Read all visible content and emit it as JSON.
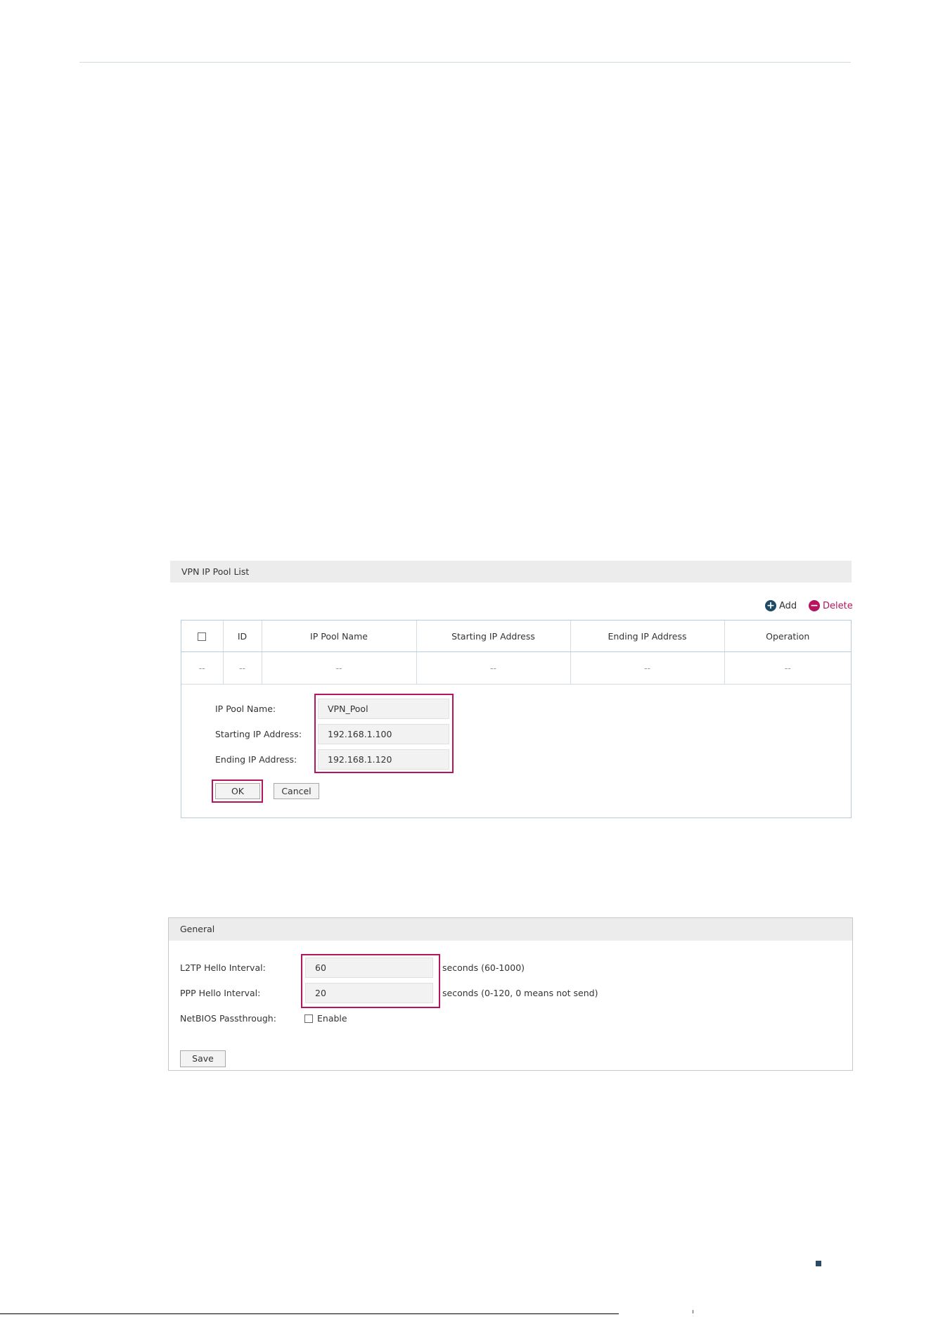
{
  "pool_panel": {
    "title": "VPN IP Pool List",
    "add_label": "Add",
    "delete_label": "Delete",
    "columns": [
      "ID",
      "IP Pool Name",
      "Starting IP Address",
      "Ending IP Address",
      "Operation"
    ],
    "empty_row": [
      "--",
      "--",
      "--",
      "--",
      "--",
      "--"
    ],
    "form": {
      "name_label": "IP Pool Name:",
      "name_value": "VPN_Pool",
      "start_label": "Starting IP Address:",
      "start_value": "192.168.1.100",
      "end_label": "Ending IP Address:",
      "end_value": "192.168.1.120",
      "ok_label": "OK",
      "cancel_label": "Cancel"
    }
  },
  "general_panel": {
    "title": "General",
    "l2tp_label": "L2TP Hello Interval:",
    "l2tp_value": "60",
    "l2tp_hint": "seconds (60-1000)",
    "ppp_label": "PPP Hello Interval:",
    "ppp_value": "20",
    "ppp_hint": "seconds (0-120, 0 means not send)",
    "netbios_label": "NetBIOS Passthrough:",
    "enable_label": "Enable",
    "save_label": "Save"
  },
  "icons": {
    "add": "plus-circle-icon",
    "delete": "minus-circle-icon"
  },
  "colors": {
    "accent": "#b5155f",
    "add_icon": "#1e4a63",
    "header_bg": "#ececec",
    "table_border": "#b9ccd9"
  }
}
